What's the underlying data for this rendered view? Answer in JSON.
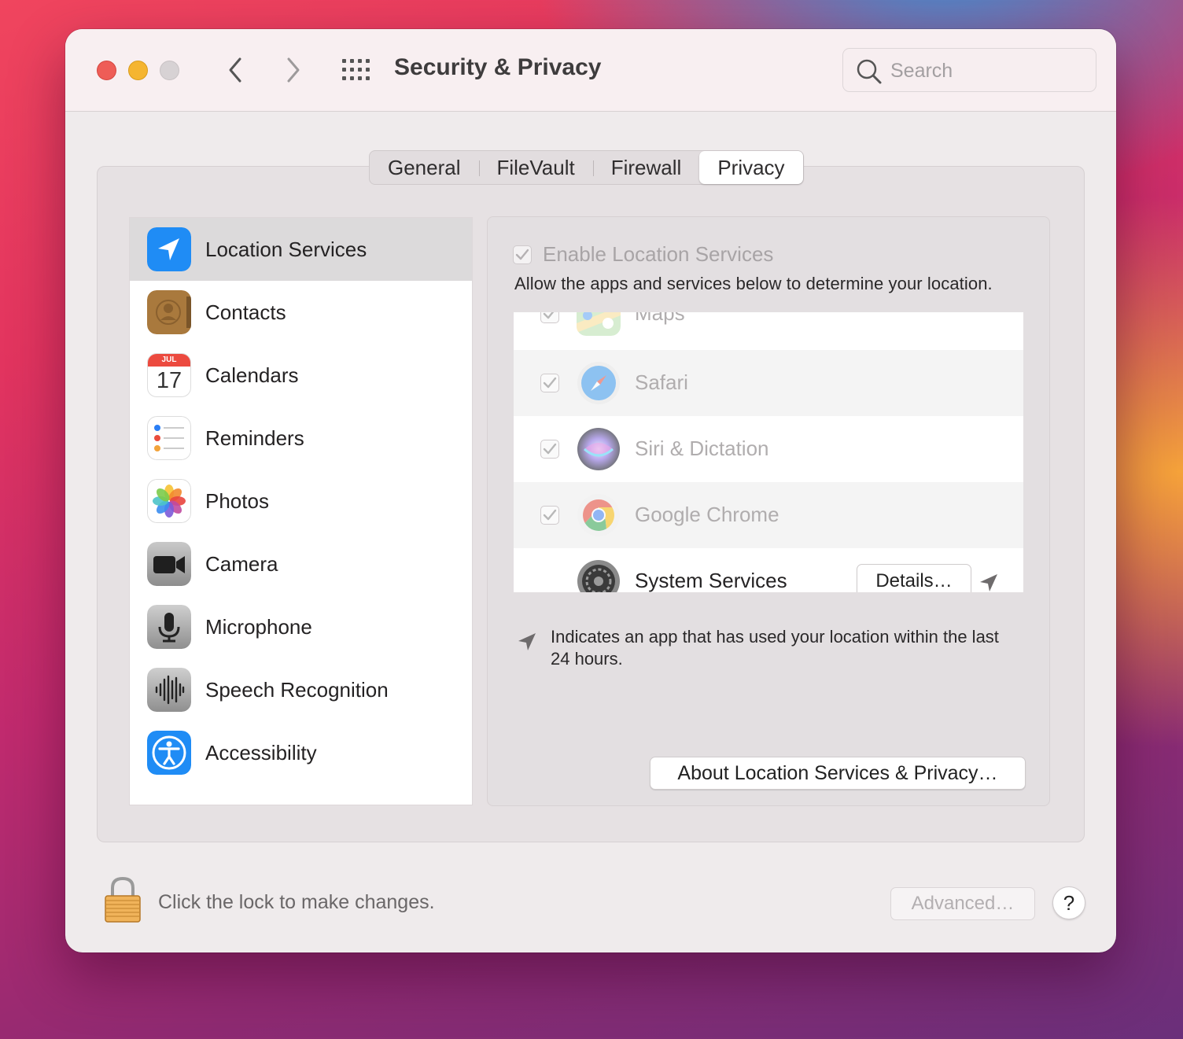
{
  "window": {
    "title": "Security & Privacy",
    "search_placeholder": "Search"
  },
  "tabs": [
    {
      "label": "General",
      "active": false
    },
    {
      "label": "FileVault",
      "active": false
    },
    {
      "label": "Firewall",
      "active": false
    },
    {
      "label": "Privacy",
      "active": true
    }
  ],
  "sidebar": {
    "items": [
      {
        "label": "Location Services",
        "icon": "location-arrow-icon",
        "selected": true
      },
      {
        "label": "Contacts",
        "icon": "contacts-icon"
      },
      {
        "label": "Calendars",
        "icon": "calendar-icon",
        "calendar_month": "JUL",
        "calendar_day": "17"
      },
      {
        "label": "Reminders",
        "icon": "reminders-icon"
      },
      {
        "label": "Photos",
        "icon": "photos-icon"
      },
      {
        "label": "Camera",
        "icon": "camera-icon"
      },
      {
        "label": "Microphone",
        "icon": "microphone-icon"
      },
      {
        "label": "Speech Recognition",
        "icon": "speech-waveform-icon"
      },
      {
        "label": "Accessibility",
        "icon": "accessibility-icon"
      }
    ]
  },
  "location": {
    "enable_label": "Enable Location Services",
    "enable_checked": true,
    "description": "Allow the apps and services below to determine your location.",
    "apps": [
      {
        "name": "Maps",
        "checked": true,
        "icon": "maps-icon"
      },
      {
        "name": "Safari",
        "checked": true,
        "icon": "safari-icon"
      },
      {
        "name": "Siri & Dictation",
        "checked": true,
        "icon": "siri-icon"
      },
      {
        "name": "Google Chrome",
        "checked": true,
        "icon": "chrome-icon"
      },
      {
        "name": "System Services",
        "icon": "system-preferences-gear-icon",
        "details_label": "Details…"
      }
    ],
    "legend": "Indicates an app that has used your location within the last 24 hours.",
    "about_label": "About Location Services & Privacy…"
  },
  "footer": {
    "lock_text": "Click the lock to make changes.",
    "advanced_label": "Advanced…",
    "help_label": "?"
  },
  "colors": {
    "accent_blue": "#1f8cf5",
    "close": "#ee5d57",
    "minimize": "#f5b530"
  }
}
